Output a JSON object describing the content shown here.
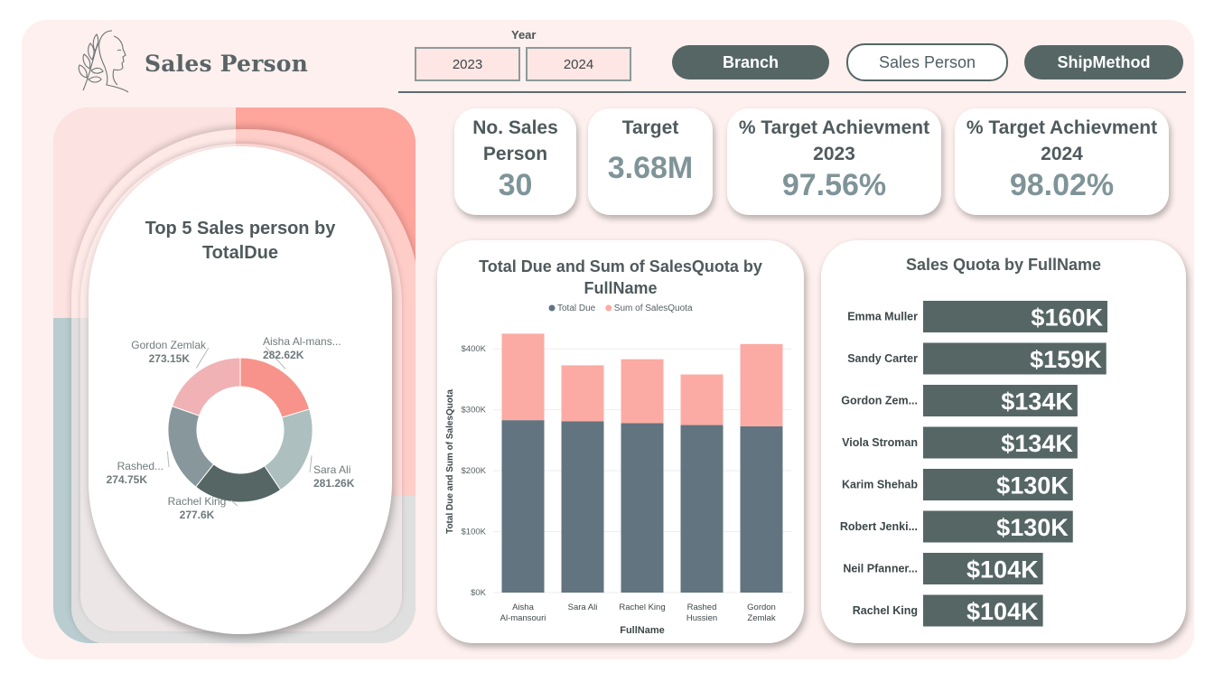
{
  "header": {
    "title": "Sales Person",
    "year_filter": {
      "label": "Year",
      "options": [
        "2023",
        "2024"
      ]
    },
    "nav": {
      "branch": "Branch",
      "sales_person": "Sales Person",
      "ship_method": "ShipMethod"
    }
  },
  "kpis": {
    "sales_count": {
      "label_line1": "No. Sales",
      "label_line2": "Person",
      "value": "30"
    },
    "target": {
      "label": "Target",
      "value": "3.68M"
    },
    "achievement_2023": {
      "label_line1": "% Target Achievment",
      "label_line2": "2023",
      "value": "97.56%"
    },
    "achievement_2024": {
      "label_line1": "% Target Achievment",
      "label_line2": "2024",
      "value": "98.02%"
    }
  },
  "donut": {
    "title_line1": "Top 5 Sales person by",
    "title_line2": "TotalDue"
  },
  "combo": {
    "title_line1": "Total Due and Sum of SalesQuota by",
    "title_line2": "FullName"
  },
  "quota": {
    "title": "Sales Quota by FullName"
  },
  "colors": {
    "dark": "#556665",
    "bar_slate": "#627480",
    "pink": "#fbaba4",
    "canvas": "#fdf0ee"
  },
  "chart_data": [
    {
      "type": "pie",
      "slices": [
        {
          "label": "Aisha Al-mans...",
          "value": 282.62,
          "value_label": "282.62K",
          "color": "#f7938a"
        },
        {
          "label": "Sara Ali",
          "value": 281.26,
          "value_label": "281.26K",
          "color": "#adbfbf"
        },
        {
          "label": "Rachel King",
          "value": 277.6,
          "value_label": "277.6K",
          "color": "#556665"
        },
        {
          "label": "Rashed...",
          "value": 274.75,
          "value_label": "274.75K",
          "color": "#88979b"
        },
        {
          "label": "Gordon Zemlak",
          "value": 273.15,
          "value_label": "273.15K",
          "color": "#f0b2b5"
        }
      ]
    },
    {
      "type": "bar",
      "stacked": true,
      "categories": [
        [
          "Aisha",
          "Al-mansouri"
        ],
        [
          "Sara Ali"
        ],
        [
          "Rachel King"
        ],
        [
          "Rashed",
          "Hussien"
        ],
        [
          "Gordon",
          "Zemlak"
        ]
      ],
      "series": [
        {
          "name": "Total Due",
          "values": [
            283,
            281,
            278,
            275,
            273
          ],
          "color": "#627480"
        },
        {
          "name": "Sum of SalesQuota",
          "values": [
            142,
            92,
            105,
            83,
            135
          ],
          "color": "#fbaba4"
        }
      ],
      "xlabel": "FullName",
      "ylabel": "Total Due and Sum of SalesQuota",
      "ylim": [
        0,
        430
      ],
      "yticks": [
        0,
        100,
        200,
        300,
        400
      ],
      "ytick_labels": [
        "$0K",
        "$100K",
        "$200K",
        "$300K",
        "$400K"
      ],
      "legend": "top-center",
      "grid": true
    },
    {
      "type": "bar",
      "orientation": "horizontal",
      "categories": [
        "Emma Muller",
        "Sandy Carter",
        "Gordon Zem...",
        "Viola Stroman",
        "Karim Shehab",
        "Robert Jenki...",
        "Neil Pfanner...",
        "Rachel King"
      ],
      "values": [
        160,
        159,
        134,
        134,
        130,
        130,
        104,
        104
      ],
      "value_labels": [
        "$160K",
        "$159K",
        "$134K",
        "$134K",
        "$130K",
        "$130K",
        "$104K",
        "$104K"
      ],
      "color": "#556665"
    }
  ]
}
